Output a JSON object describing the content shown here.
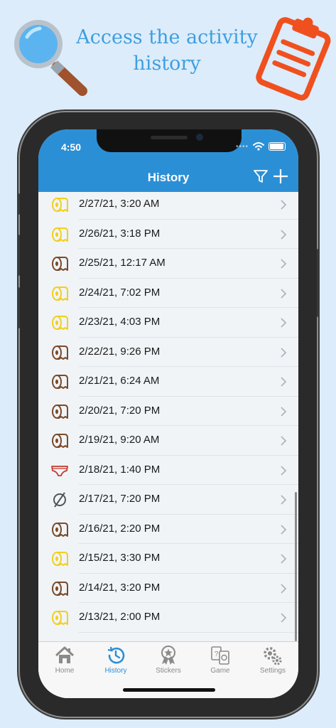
{
  "promo": {
    "headline_line1": "Access the activity",
    "headline_line2": "history"
  },
  "status_bar": {
    "time": "4:50"
  },
  "nav": {
    "title": "History",
    "filter_icon": "filter-icon",
    "add_icon": "plus-icon"
  },
  "history": [
    {
      "label": "2/27/21, 3:20 AM",
      "type": "pee"
    },
    {
      "label": "2/26/21, 3:18 PM",
      "type": "pee"
    },
    {
      "label": "2/25/21, 12:17 AM",
      "type": "poop"
    },
    {
      "label": "2/24/21, 7:02 PM",
      "type": "pee"
    },
    {
      "label": "2/23/21, 4:03 PM",
      "type": "pee"
    },
    {
      "label": "2/22/21, 9:26 PM",
      "type": "poop"
    },
    {
      "label": "2/21/21, 6:24 AM",
      "type": "poop"
    },
    {
      "label": "2/20/21, 7:20 PM",
      "type": "poop"
    },
    {
      "label": "2/19/21, 9:20 AM",
      "type": "poop"
    },
    {
      "label": "2/18/21, 1:40 PM",
      "type": "accident"
    },
    {
      "label": "2/17/21, 7:20 PM",
      "type": "none"
    },
    {
      "label": "2/16/21, 2:20 PM",
      "type": "poop"
    },
    {
      "label": "2/15/21, 3:30 PM",
      "type": "pee"
    },
    {
      "label": "2/14/21, 3:20 PM",
      "type": "poop"
    },
    {
      "label": "2/13/21, 2:00 PM",
      "type": "pee"
    }
  ],
  "tabs": [
    {
      "label": "Home",
      "icon": "home-icon",
      "active": false
    },
    {
      "label": "History",
      "icon": "history-icon",
      "active": true
    },
    {
      "label": "Stickers",
      "icon": "award-icon",
      "active": false
    },
    {
      "label": "Game",
      "icon": "cards-icon",
      "active": false
    },
    {
      "label": "Settings",
      "icon": "gears-icon",
      "active": false
    }
  ],
  "colors": {
    "accent": "#2b8fd6",
    "pee": "#f2cf1e",
    "poop": "#7b4a2a",
    "accident": "#c0392b",
    "promo_text": "#3d9fe0",
    "clipboard": "#f0501e"
  }
}
